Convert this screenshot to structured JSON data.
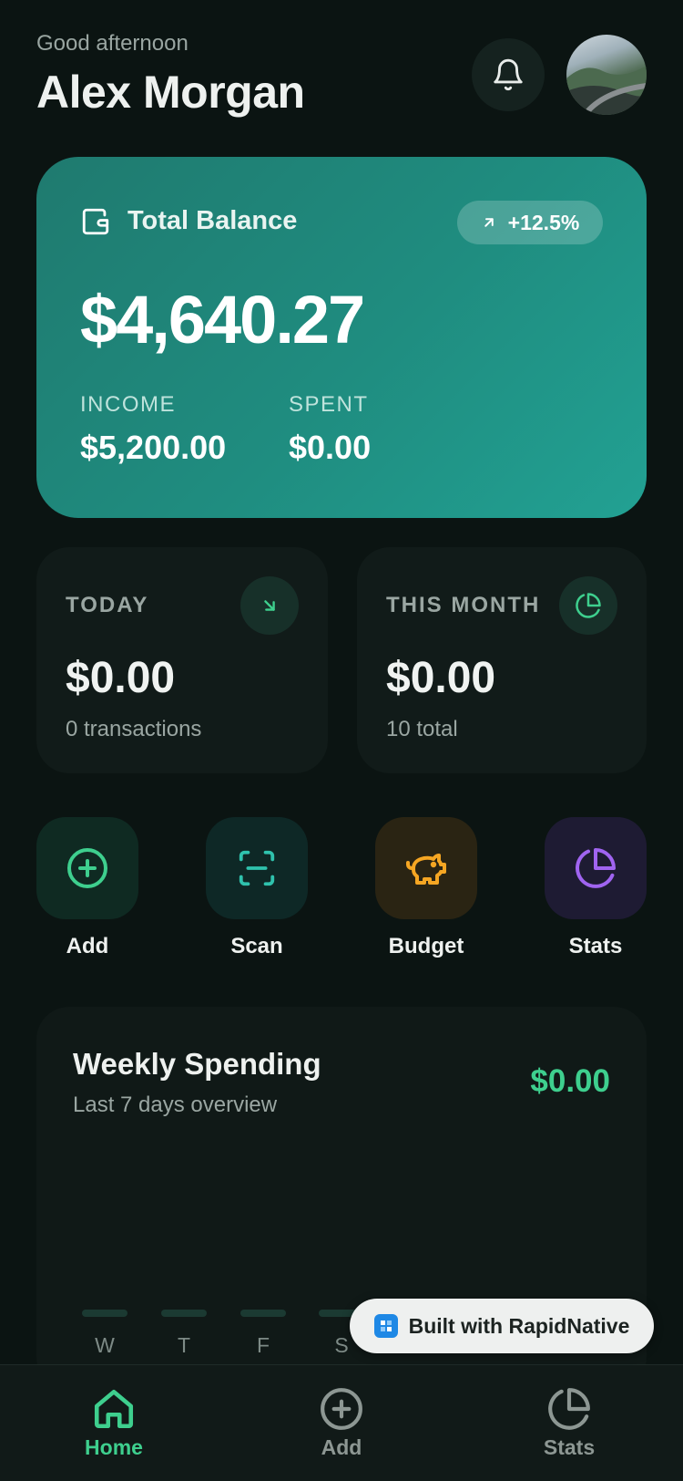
{
  "header": {
    "greeting": "Good afternoon",
    "user_name": "Alex Morgan"
  },
  "balance_card": {
    "label": "Total Balance",
    "growth": "+12.5%",
    "amount": "$4,640.27",
    "income_label": "INCOME",
    "income_value": "$5,200.00",
    "spent_label": "SPENT",
    "spent_value": "$0.00"
  },
  "stats": {
    "today": {
      "label": "TODAY",
      "value": "$0.00",
      "sub": "0 transactions"
    },
    "month": {
      "label": "THIS MONTH",
      "value": "$0.00",
      "sub": "10 total"
    }
  },
  "quick_actions": [
    {
      "label": "Add",
      "icon": "plus-circle-icon"
    },
    {
      "label": "Scan",
      "icon": "scan-icon"
    },
    {
      "label": "Budget",
      "icon": "piggy-bank-icon"
    },
    {
      "label": "Stats",
      "icon": "pie-chart-icon"
    }
  ],
  "weekly": {
    "title": "Weekly Spending",
    "subtitle": "Last 7 days overview",
    "total": "$0.00",
    "days": [
      "W",
      "T",
      "F",
      "S"
    ]
  },
  "built_badge": {
    "text": "Built with RapidNative"
  },
  "bottom_nav": {
    "items": [
      {
        "label": "Home",
        "active": true
      },
      {
        "label": "Add",
        "active": false
      },
      {
        "label": "Stats",
        "active": false
      }
    ]
  },
  "colors": {
    "background": "#0b1412",
    "accent": "#3ecf8e",
    "card_teal": "#1f8d80",
    "budget": "#f5a623",
    "stats": "#a064f0"
  }
}
